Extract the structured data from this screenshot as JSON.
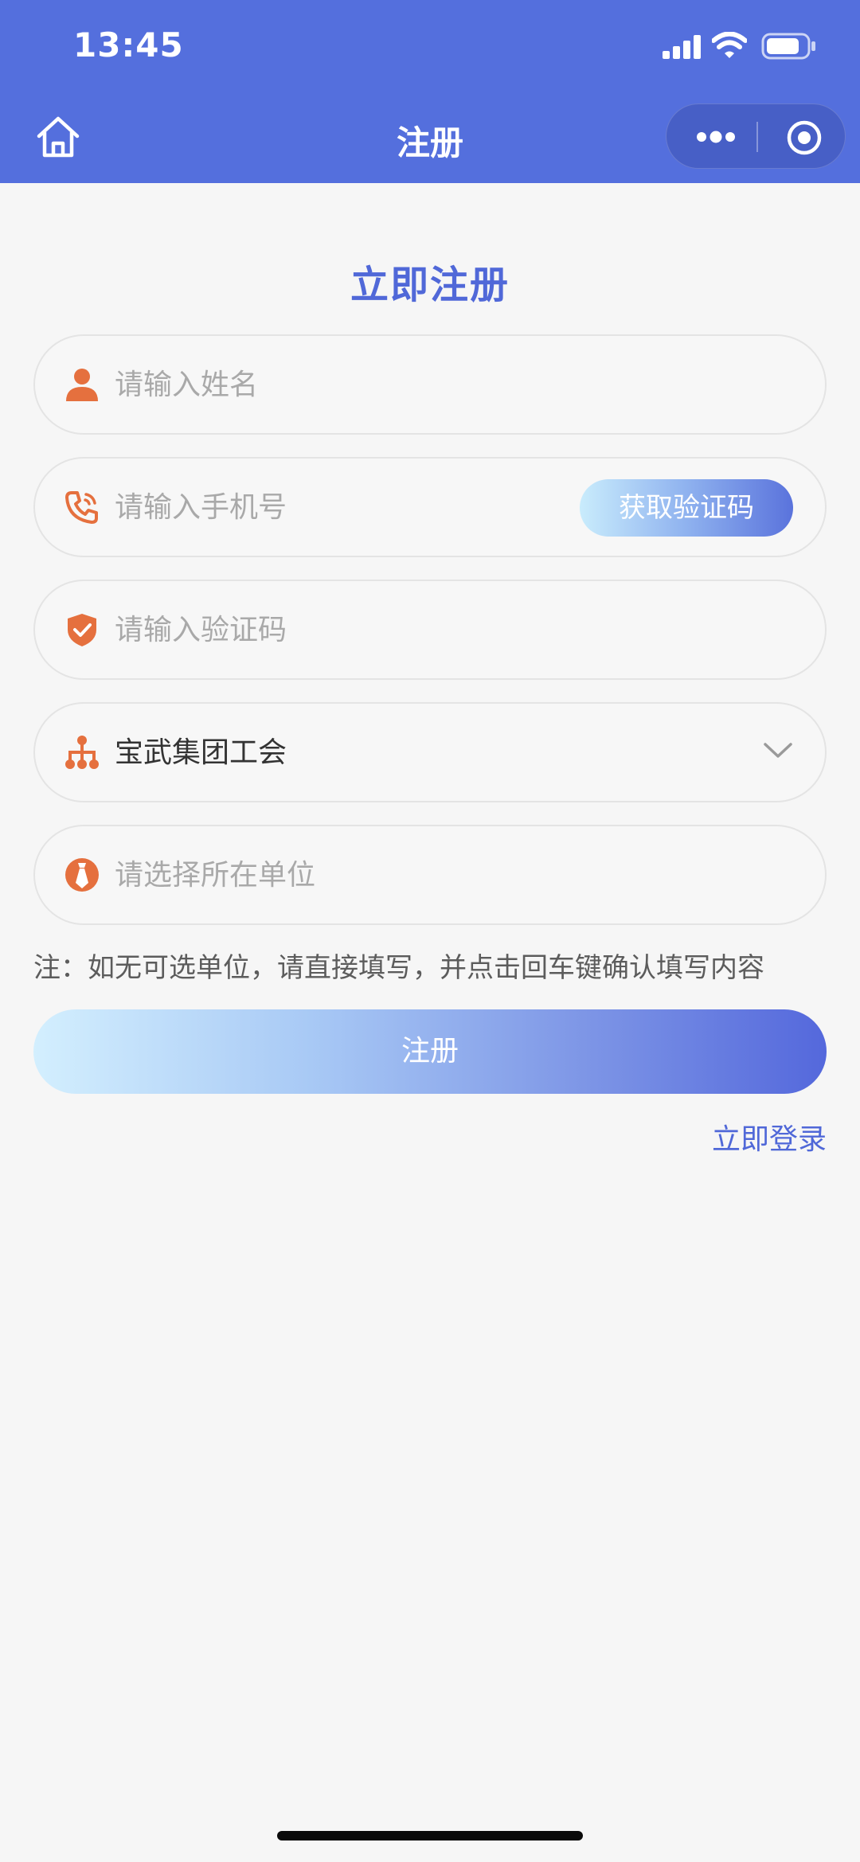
{
  "status_bar": {
    "time": "13:45"
  },
  "nav": {
    "title": "注册"
  },
  "form": {
    "heading": "立即注册",
    "name_placeholder": "请输入姓名",
    "phone_placeholder": "请输入手机号",
    "get_code_label": "获取验证码",
    "code_placeholder": "请输入验证码",
    "organization_value": "宝武集团工会",
    "unit_placeholder": "请选择所在单位",
    "note": "注：如无可选单位，请直接填写，并点击回车键确认填写内容",
    "submit_label": "注册",
    "login_link": "立即登录"
  },
  "colors": {
    "primary": "#546fdd",
    "accent_text": "#5068d8",
    "icon_orange": "#e5703e"
  },
  "icons": {
    "name": "person-icon",
    "phone": "phone-icon",
    "code": "shield-check-icon",
    "organization": "org-chart-icon",
    "unit": "tie-icon"
  }
}
